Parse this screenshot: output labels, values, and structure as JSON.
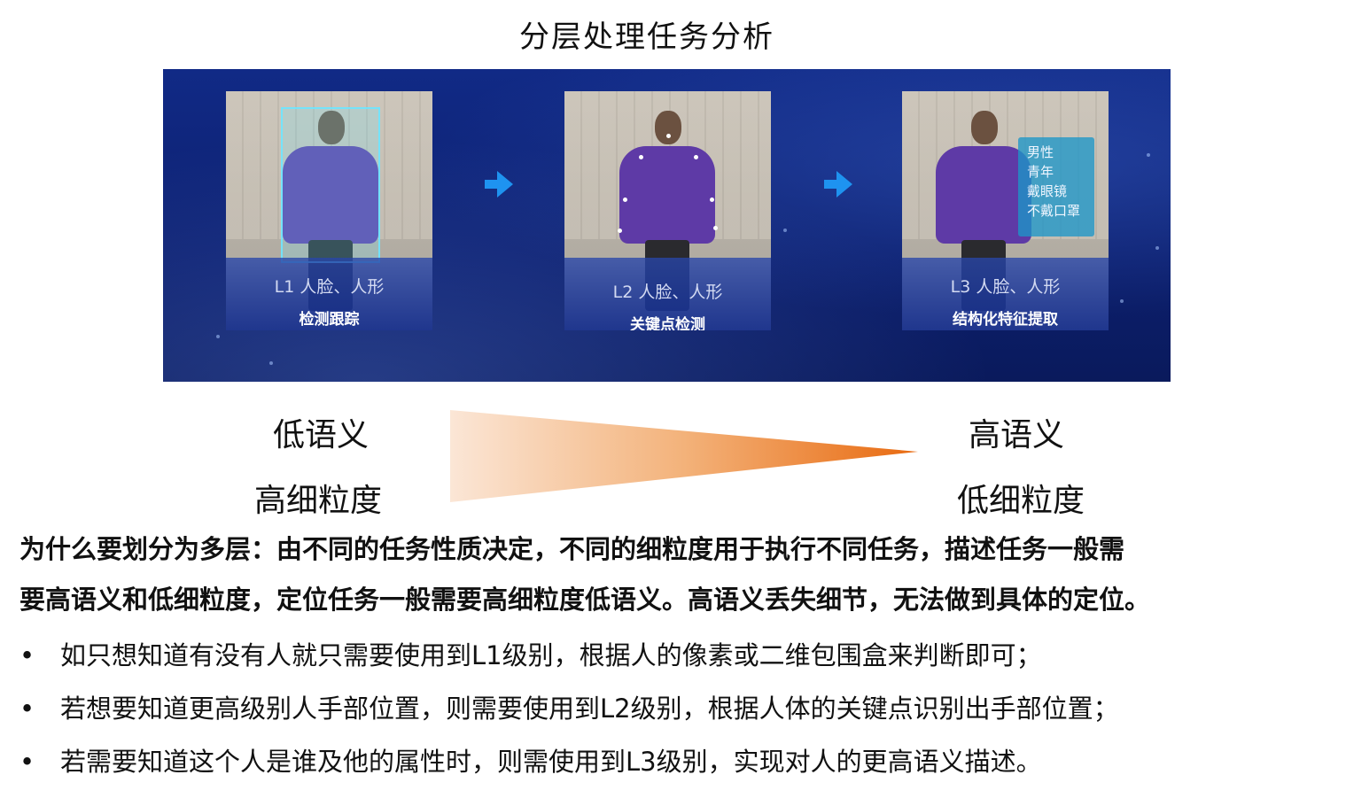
{
  "title": "分层处理任务分析",
  "cards": [
    {
      "level": "L1 人脸、人形",
      "task": "检测跟踪"
    },
    {
      "level": "L2 人脸、人形",
      "task": "关键点检测"
    },
    {
      "level": "L3 人脸、人形",
      "task": "结构化特征提取"
    }
  ],
  "attributes": [
    "男性",
    "青年",
    "戴眼镜",
    "不戴口罩"
  ],
  "scale": {
    "left_top": "低语义",
    "left_bottom": "高细粒度",
    "right_top": "高语义",
    "right_bottom": "低细粒度"
  },
  "paragraph": {
    "line1": "为什么要划分为多层：由不同的任务性质决定，不同的细粒度用于执行不同任务，描述任务一般需",
    "line2": "要高语义和低细粒度，定位任务一般需要高细粒度低语义。高语义丢失细节，无法做到具体的定位。"
  },
  "bullets": [
    "如只想知道有没有人就只需要使用到L1级别，根据人的像素或二维包围盒来判断即可；",
    "若想要知道更高级别人手部位置，则需要使用到L2级别，根据人体的关键点识别出手部位置；",
    "若需要知道这个人是谁及他的属性时，则需使用到L3级别，实现对人的更高语义描述。"
  ],
  "bullet_symbol": "•",
  "colors": {
    "banner_blue": "#0c1f6e",
    "arrow_blue": "#1e93f0",
    "triangle_orange": "#e86a10"
  }
}
